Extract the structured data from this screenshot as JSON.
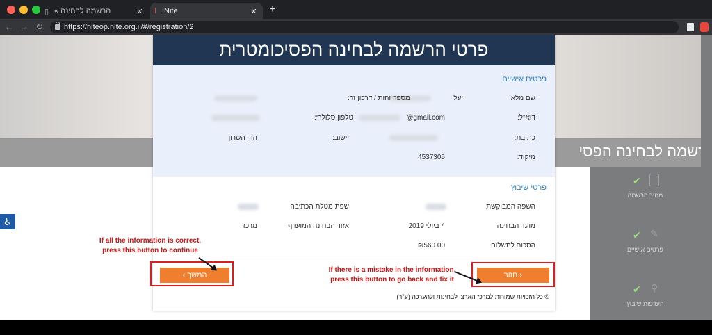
{
  "browser": {
    "tabs": [
      {
        "title": "הרשמה לבחינה »",
        "active": false
      },
      {
        "title": "Nite",
        "active": true
      }
    ],
    "new_tab": "+",
    "url": "https://niteop.nite.org.il/#/registration/2"
  },
  "background": {
    "banner_text": "הרשמה לבחינה הפסי",
    "steps": [
      {
        "label": "מחיר הרשמה"
      },
      {
        "label": "פרטים אישיים"
      },
      {
        "label": "העדפות שיבוץ"
      }
    ]
  },
  "modal": {
    "title": "פרטי הרשמה לבחינה הפסיכומטרית",
    "personal_section": "פרטים אישיים",
    "personal": {
      "name_label": "שם מלא:",
      "name_value": "יעל",
      "id_label": "מספר זהות / דרכון זר:",
      "email_label": "דוא\"ל:",
      "email_value": "@gmail.com",
      "phone_label": "טלפון סלולרי:",
      "address_label": "כתובת:",
      "city_label": "יישוב:",
      "city_value": "הוד השרון",
      "zip_label": "מיקוד:",
      "zip_value": "4537305"
    },
    "placement_section": "פרטי שיבוץ",
    "placement": {
      "language_label": "השפה המבוקשת",
      "writing_language_label": "שפת מטלת הכתיבה",
      "date_label": "מועד הבחינה",
      "date_value": "4 ביולי 2019",
      "region_label": "אזור הבחינה המועדף",
      "region_value": "מרכז",
      "price_label": "הסכום לתשלום:",
      "price_value": "₪560.00"
    },
    "next_button": "המשך ›",
    "back_button": "‹ חזור",
    "copyright": "© כל הזכויות שמורות למרכז הארצי לבחינות ולהערכה (ע\"ר)"
  },
  "annotations": {
    "left_note": [
      "If all the information is correct,",
      "press this button to continue"
    ],
    "right_note": [
      "If there is a mistake in the information,",
      "press this button to go back and fix it"
    ]
  },
  "colors": {
    "header": "#213653",
    "accent_button": "#ef7f2e",
    "section_title": "#2f84c8",
    "annotation": "#d91f1f"
  }
}
